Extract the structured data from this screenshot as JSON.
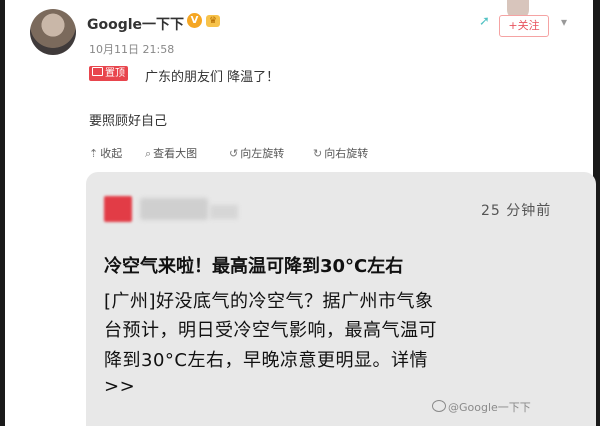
{
  "post": {
    "username": "Google一下下",
    "verified_badge": "V",
    "vip_badge": "♛",
    "timestamp": "10月11日 21:58",
    "tag_label": "置顶",
    "text_line1": "广东的朋友们 降温了！",
    "text_line2": "要照顾好自己",
    "follow_label": "+关注"
  },
  "toolbar": {
    "collapse": "收起",
    "view_image": "查看大图",
    "rotate_left": "向左旋转",
    "rotate_right": "向右旋转"
  },
  "icons": {
    "collapse": "up-arrow-icon",
    "view_image": "magnifier-icon",
    "rotate_left": "rotate-left-icon",
    "rotate_right": "rotate-right-icon"
  },
  "notification": {
    "time": "25 分钟前",
    "headline": "冷空气来啦！最高温可降到30°C左右",
    "body_lines": [
      "[广州]好没底气的冷空气？据广州市气象",
      "台预计，明日受冷空气影响，最高气温可",
      "降到30°C左右，早晚凉意更明显。详情",
      ">>"
    ]
  },
  "watermark": "@Google一下下",
  "colors": {
    "accent_red": "#e8454d",
    "card_bg": "#e8e8e8",
    "follow_text": "#e8545f"
  }
}
